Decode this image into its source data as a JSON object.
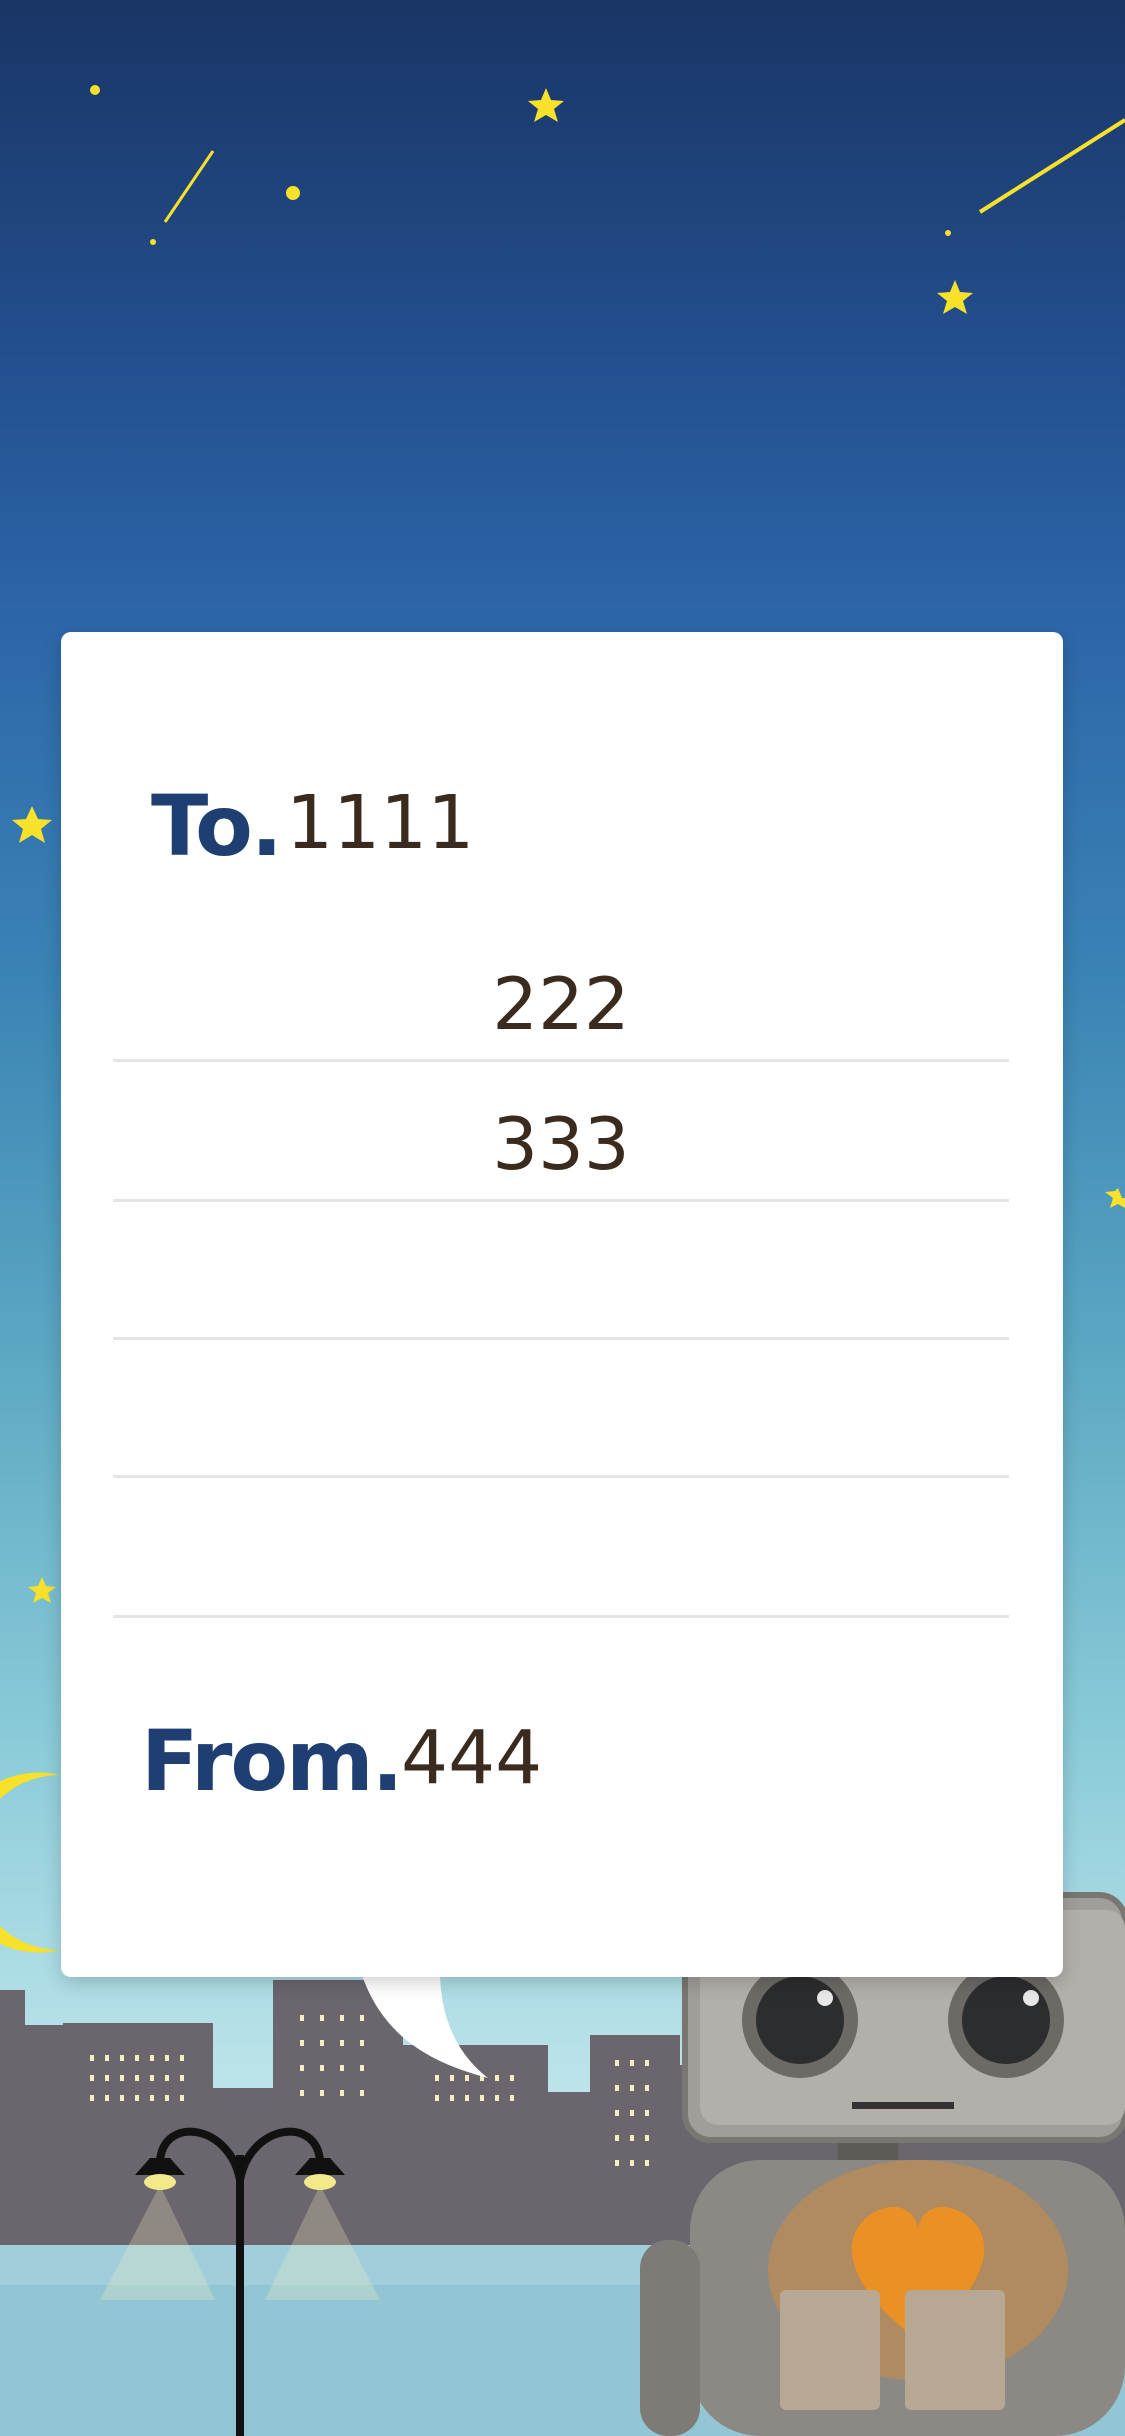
{
  "letter": {
    "to_label": "To.",
    "to_value": "1111",
    "lines": [
      "222",
      "333",
      "",
      "",
      ""
    ],
    "from_label": "From.",
    "from_value": "444"
  },
  "colors": {
    "label": "#1f3f72",
    "text": "#3b2a1e",
    "star": "#f7e12a",
    "buildings": "#6b666e"
  },
  "decorations": [
    "star-icon",
    "shooting-star-icon",
    "moon-icon",
    "street-lamp-icon",
    "city-skyline",
    "robot-illustration",
    "heart-icon"
  ]
}
